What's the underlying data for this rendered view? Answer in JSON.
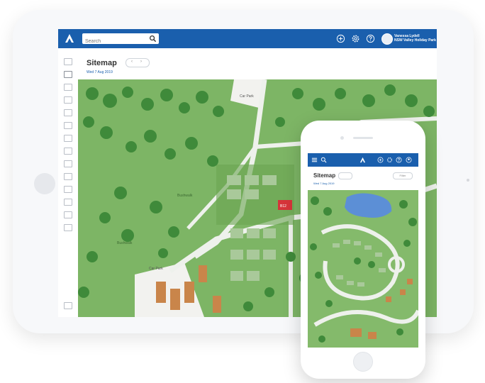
{
  "app": {
    "search_placeholder": "Search",
    "user_name": "Vanessa Lydell",
    "user_org": "NSW Valley Holiday Park"
  },
  "page": {
    "title": "Sitemap",
    "date": "Wed 7 Aug 2019",
    "prev": "‹",
    "next": "›"
  },
  "phone": {
    "title": "Sitemap",
    "date": "Wed 7 Aug 2019",
    "action_label": "Filter"
  },
  "map_labels": {
    "car_park_1": "Car Park",
    "car_park_2": "Car Park",
    "area_1": "Bushwalk",
    "area_2": "Bushwalk",
    "selected_site": "B12"
  },
  "colors": {
    "brand_blue": "#1a5fad",
    "grass": "#7db565",
    "tree": "#3f8a3a",
    "selected": "#d6343a",
    "cabin": "#c9854a"
  }
}
